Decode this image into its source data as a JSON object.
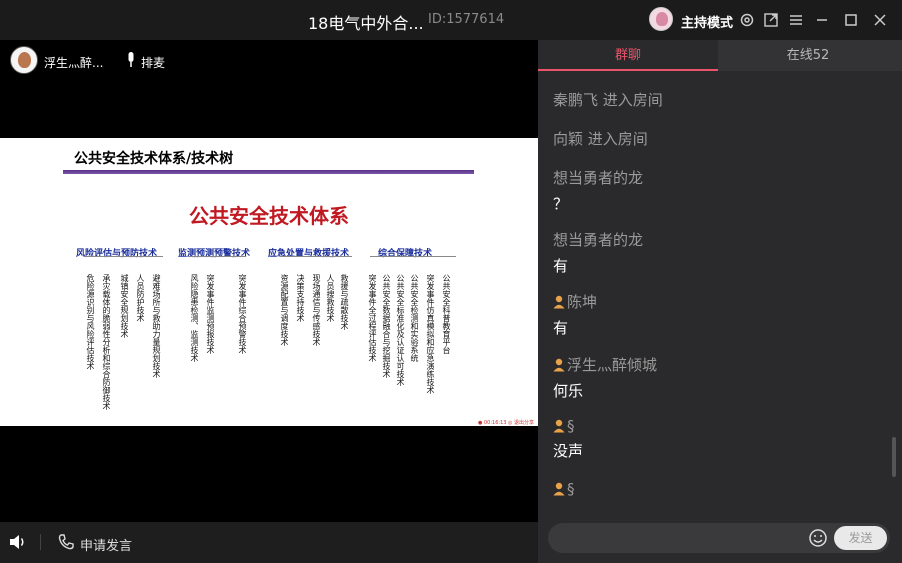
{
  "window": {
    "title": "18电气中外合...",
    "room_id": "ID:1577614",
    "host_mode_label": "主持模式"
  },
  "presenter": {
    "name": "浮生灬醉...",
    "mic_label": "排麦"
  },
  "slide": {
    "title": "公共安全技术体系/技术树",
    "main_heading": "公共安全技术体系",
    "categories": [
      "风险评估与预防技术",
      "监测预测预警技术",
      "应急处置与救援技术",
      "综合保障技术"
    ],
    "leaves": [
      "危险源识别与风险评估技术",
      "承灾载体的脆弱性分析和综合防御技术",
      "城镇安全规划技术",
      "人员防护技术",
      "避难场所与救助力量规划技术",
      "风险隐患检测、监测技术",
      "突发事件监测预报技术",
      "突发事件综合预警技术",
      "资源配置与调度技术",
      "决策支持技术",
      "现场通信与传感技术",
      "人员搜救技术",
      "救援与疏散技术",
      "突发事件全过程评估技术",
      "公共安全数据融合与挖掘技术",
      "公共安全标准化及认证认可技术",
      "公共安全检测和实验系统",
      "突发事件仿真模拟和应急演练技术",
      "公共安全科普教育平台"
    ],
    "recording_label": "● 00:16:13  ◎ 退出分享"
  },
  "bottom_bar": {
    "apply_label": "申请发言"
  },
  "chat": {
    "tabs": [
      "群聊",
      "在线52"
    ],
    "messages": [
      {
        "nick": "秦鹏飞 进入房间",
        "text": ""
      },
      {
        "nick": "向颖 进入房间",
        "text": ""
      },
      {
        "nick": "想当勇者的龙",
        "text": "？"
      },
      {
        "nick": "想当勇者的龙",
        "text": "有"
      },
      {
        "nick": "陈坤",
        "text": "有"
      },
      {
        "nick": "浮生灬醉倾城",
        "text": "何乐"
      },
      {
        "nick": "§",
        "text": "没声"
      },
      {
        "nick": "§",
        "text": ""
      }
    ],
    "input_placeholder": "",
    "send_label": "发送"
  },
  "colors": {
    "accent": "#e8546a",
    "slide_heading": "#c01922",
    "category_blue": "#1b2e9b"
  }
}
